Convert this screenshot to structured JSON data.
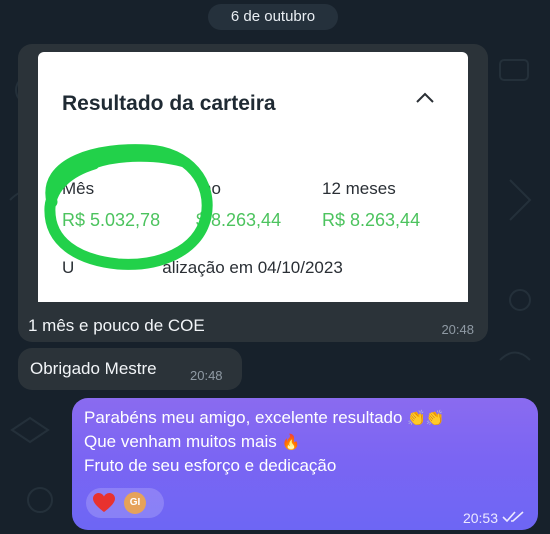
{
  "date_header": "6 de outubro",
  "messages": {
    "photo": {
      "card": {
        "title": "Resultado da carteira",
        "columns": [
          {
            "label": "Mês",
            "value": "R$ 5.032,78"
          },
          {
            "label": "no",
            "value": "$ 8.263,44"
          },
          {
            "label": "12 meses",
            "value": "R$ 8.263,44"
          }
        ],
        "update_prefix": "U",
        "update_text": "alização em 04/10/2023"
      },
      "caption": "1 mês e pouco de COE",
      "time": "20:48"
    },
    "thanks": {
      "text": "Obrigado Mestre",
      "time": "20:48"
    },
    "outgoing": {
      "line1": "Parabéns meu amigo, excelente resultado",
      "line1_emoji": "👏👏",
      "line2": "Que venham muitos mais",
      "line2_emoji": "🔥",
      "line3": "Fruto de seu esforço e dedicação",
      "reaction_avatar": "GI",
      "time": "20:53"
    }
  },
  "colors": {
    "background": "#17212b",
    "incoming_bubble": "#2b3339",
    "outgoing_top": "#8a6bf0",
    "outgoing_bottom": "#6d66f4",
    "value_green": "#4cc35e",
    "marker_green": "#22d14a"
  },
  "icons": {
    "collapse": "chevron-up-icon",
    "reaction": "heart-icon",
    "read_status": "double-check-icon"
  }
}
